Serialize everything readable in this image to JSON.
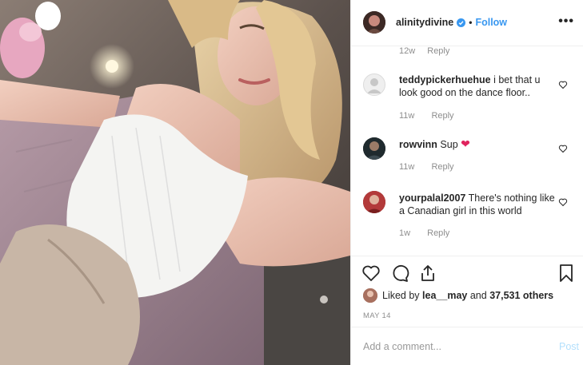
{
  "header": {
    "username": "alinitydivine",
    "separator": "•",
    "follow_label": "Follow",
    "more_label": "•••"
  },
  "partial_comment": {
    "time": "12w",
    "reply_label": "Reply"
  },
  "comments": [
    {
      "username": "teddypickerhuehue",
      "text": "i bet that u look good on the dance floor..",
      "time": "11w",
      "reply_label": "Reply"
    },
    {
      "username": "rowvinn",
      "text": "Sup",
      "emoji": "❤",
      "time": "11w",
      "reply_label": "Reply"
    },
    {
      "username": "yourpalal2007",
      "text": "There's nothing like a Canadian girl in this world",
      "time": "1w",
      "reply_label": "Reply"
    }
  ],
  "likes": {
    "prefix": "Liked by",
    "liker": "lea__may",
    "middle": "and",
    "others": "37,531 others"
  },
  "post_date": "MAY 14",
  "add_comment": {
    "placeholder": "Add a comment...",
    "post_label": "Post"
  },
  "colors": {
    "accent": "#3897f0",
    "post_disabled": "#b2dffc",
    "muted": "#8e8e8e",
    "heart_emoji": "#e0245e"
  },
  "icons": [
    "verified-badge-icon",
    "more-options-icon",
    "heart-outline-icon",
    "comment-icon",
    "share-icon",
    "bookmark-icon",
    "heart-emoji-icon"
  ]
}
